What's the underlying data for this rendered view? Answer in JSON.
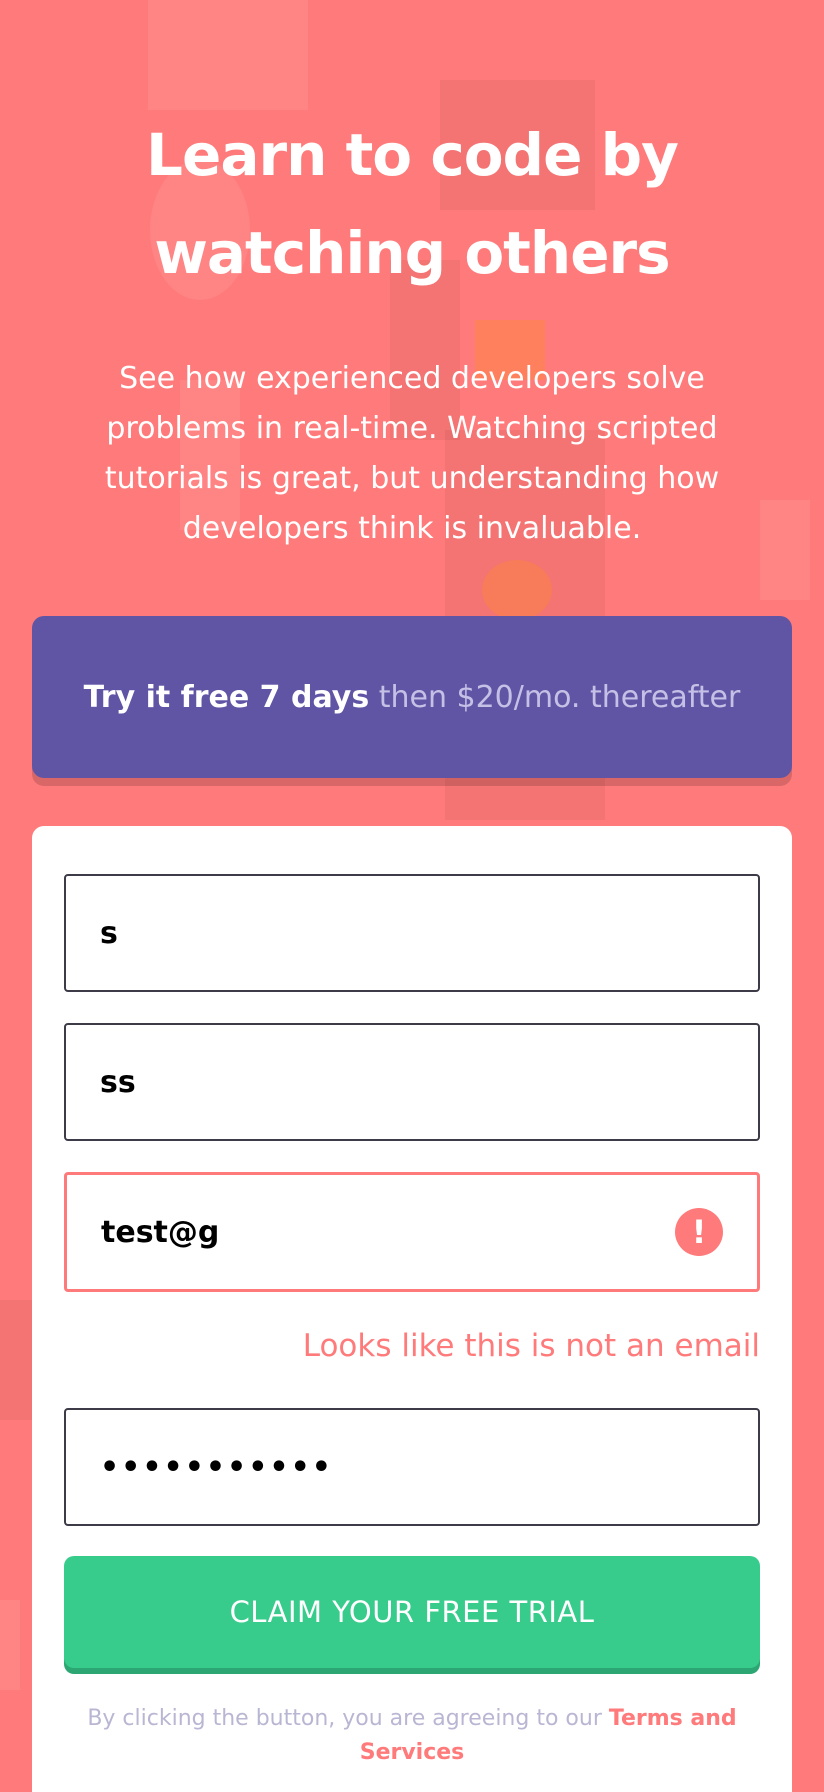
{
  "hero": {
    "title": "Learn to code by watching others",
    "description": "See how experienced developers solve problems in real-time. Watching scripted tutorials is great, but understanding how developers think is invaluable."
  },
  "promo": {
    "bold_text": "Try it free 7 days",
    "rest_text": " then $20/mo. thereafter"
  },
  "form": {
    "first_name_value": "s",
    "last_name_value": "ss",
    "email_value": "test@g",
    "email_error": "Looks like this is not an email",
    "password_value": "•••••••••••",
    "submit_label": "CLAIM YOUR FREE TRIAL",
    "terms_text": "By clicking the button, you are agreeing to our ",
    "terms_link": "Terms and Services"
  },
  "colors": {
    "background": "#ff7a7a",
    "promo": "#6055a5",
    "cta": "#38cc8c",
    "error": "#ff7a7a"
  },
  "icons": {
    "email_error": "exclamation-icon"
  }
}
